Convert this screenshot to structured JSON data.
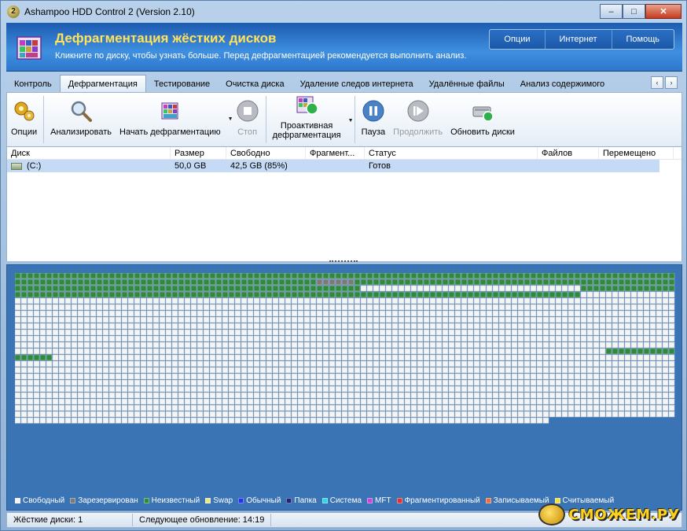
{
  "window": {
    "title": "Ashampoo HDD Control 2 (Version 2.10)",
    "controls": {
      "minimize": "–",
      "maximize": "□",
      "close": "✕"
    }
  },
  "banner": {
    "title": "Дефрагментация жёстких дисков",
    "subtitle": "Кликните по диску, чтобы узнать больше. Перед дефрагментацией рекомендуется выполнить анализ.",
    "menu": [
      "Опции",
      "Интернет",
      "Помощь"
    ]
  },
  "tabs": {
    "items": [
      "Контроль",
      "Дефрагментация",
      "Тестирование",
      "Очистка диска",
      "Удаление следов интернета",
      "Удалённые файлы",
      "Анализ содержимого"
    ],
    "active_index": 1,
    "prev": "‹",
    "next": "›"
  },
  "toolbar": {
    "options": "Опции",
    "analyze": "Анализировать",
    "start_defrag": "Начать дефрагментацию",
    "stop": "Стоп",
    "proactive_line1": "Проактивная",
    "proactive_line2": "дефрагментация",
    "pause": "Пауза",
    "resume": "Продолжить",
    "refresh": "Обновить диски",
    "icons": {
      "options": "gears-icon",
      "analyze": "magnifier-icon",
      "start_defrag": "defrag-start-icon",
      "stop": "stop-icon",
      "proactive": "proactive-defrag-icon",
      "pause": "pause-icon",
      "resume": "play-icon",
      "refresh": "refresh-disks-icon"
    }
  },
  "disk_table": {
    "columns": [
      "Диск",
      "Размер",
      "Свободно",
      "Фрагмент...",
      "Статус",
      "Файлов",
      "Перемещено"
    ],
    "rows": [
      {
        "disk": "(C:)",
        "size": "50,0 GB",
        "free": "42,5 GB (85%)",
        "fragmented": "",
        "status": "Готов",
        "files": "",
        "moved": ""
      }
    ]
  },
  "legend": [
    {
      "label": "Свободный",
      "color": "#f4f4f4"
    },
    {
      "label": "Зарезервирован",
      "color": "#7a7a7a"
    },
    {
      "label": "Неизвестный",
      "color": "#2e8b3a"
    },
    {
      "label": "Swap",
      "color": "#e8e88a"
    },
    {
      "label": "Обычный",
      "color": "#2233ee"
    },
    {
      "label": "Папка",
      "color": "#23237a"
    },
    {
      "label": "Система",
      "color": "#33d6e6"
    },
    {
      "label": "MFT",
      "color": "#c646d6"
    },
    {
      "label": "Фрагментированный",
      "color": "#e03030"
    },
    {
      "label": "Записываемый",
      "color": "#e87040"
    },
    {
      "label": "Считываемый",
      "color": "#f0e040"
    }
  ],
  "status_bar": {
    "disks": "Жёсткие диски: 1",
    "next_update": "Следующее обновление: 14:19"
  },
  "watermark": "СМОЖЕМ.РУ",
  "colors": {
    "cell_free": "#f4f4f4",
    "cell_unknown": "#2e8b3a",
    "cell_reserved": "#7a7a7a",
    "map_bg": "#3b74b4"
  }
}
